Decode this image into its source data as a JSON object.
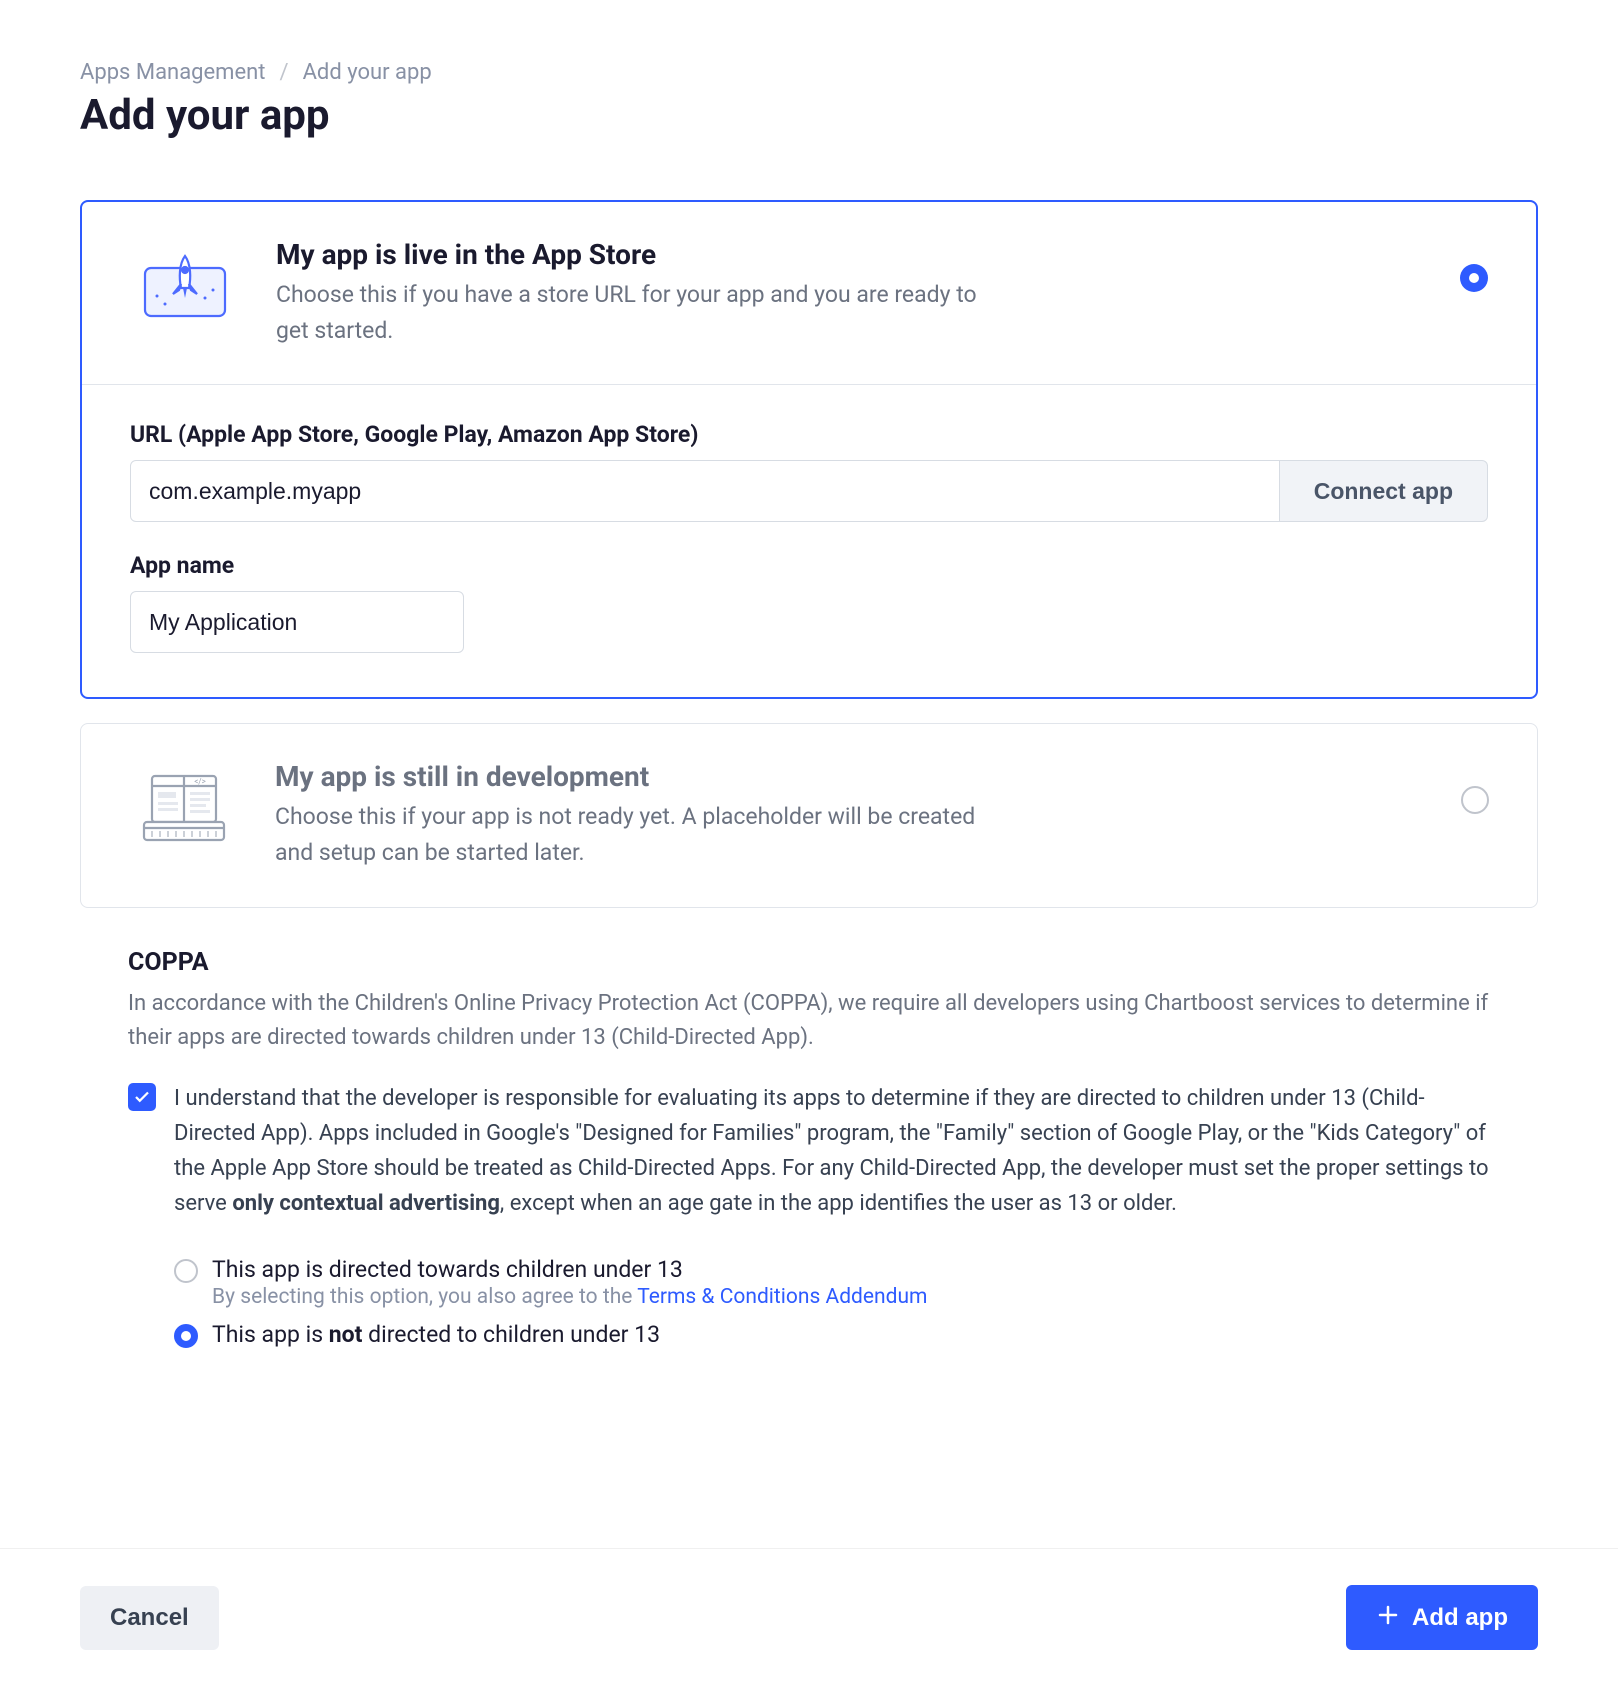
{
  "breadcrumb": {
    "parent": "Apps Management",
    "current": "Add your app"
  },
  "page_title": "Add your app",
  "option_live": {
    "title": "My app is live in the App Store",
    "desc": "Choose this if you have a store URL for your app and you are ready to get started.",
    "selected": true,
    "url_label": "URL (Apple App Store, Google Play, Amazon App Store)",
    "url_value": "com.example.myapp",
    "connect_label": "Connect app",
    "appname_label": "App name",
    "appname_value": "My Application"
  },
  "option_dev": {
    "title": "My app is still in development",
    "desc": "Choose this if your app is not ready yet. A placeholder will be created and setup can be started later.",
    "selected": false
  },
  "coppa": {
    "title": "COPPA",
    "intro": "In accordance with the Children's Online Privacy Protection Act (COPPA), we require all developers using Chartboost services to determine if their apps are directed towards children under 13 (Child-Directed App).",
    "ack_checked": true,
    "ack_pre": "I understand that the developer is responsible for evaluating its apps to determine if they are directed to children under 13 (Child-Directed App). Apps included in Google's \"Designed for Families\" program, the \"Family\" section of Google Play, or the \"Kids Category\" of the Apple App Store should be treated as Child-Directed Apps. For any Child-Directed App, the developer must set the proper settings to serve ",
    "ack_bold": "only contextual advertising",
    "ack_post": ", except when an age gate in the app identifies the user as 13 or older.",
    "radio_under13": {
      "label": "This app is directed towards children under 13",
      "sub_pre": "By selecting this option, you also agree to the ",
      "sub_link": "Terms & Conditions Addendum",
      "selected": false
    },
    "radio_not": {
      "pre": "This app is ",
      "bold": "not",
      "post": " directed to children under 13",
      "selected": true
    }
  },
  "footer": {
    "cancel": "Cancel",
    "submit": "Add app"
  }
}
